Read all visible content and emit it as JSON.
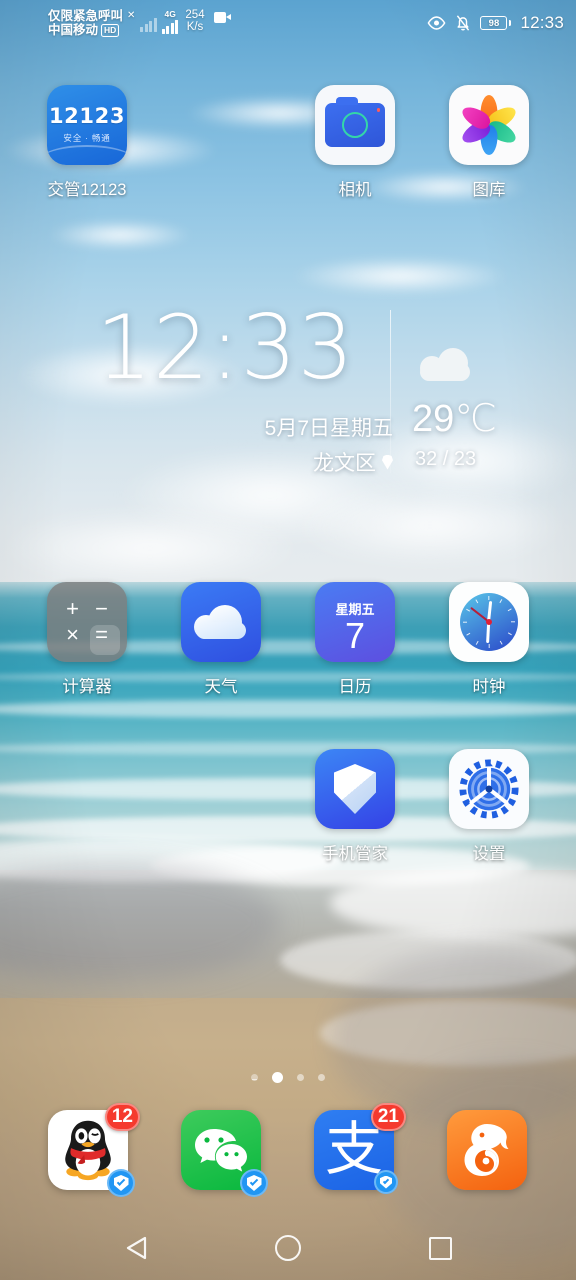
{
  "statusbar": {
    "carrier_line1": "仅限紧急呼叫",
    "carrier_line2": "中国移动",
    "hd_badge": "HD",
    "x_mark": "✕",
    "network_type": "4G",
    "net_speed_value": "254",
    "net_speed_unit": "K/s",
    "recording_icon": "video-camera-icon",
    "eye_icon": "eye-icon",
    "mute_icon": "bell-muted-icon",
    "battery_percent": "98",
    "time": "12:33"
  },
  "widget": {
    "time": "12:33",
    "date": "5月7日星期五",
    "location": "龙文区",
    "location_icon": "map-pin-icon",
    "weather_icon": "cloud-icon",
    "temperature": "29℃",
    "temp_range": "32 / 23"
  },
  "home_rows": [
    {
      "apps": [
        {
          "label": "交管12123",
          "icon": "app-12123-icon",
          "icon_text": "12123",
          "icon_subtext": "安全 · 畅通"
        },
        {
          "label": "相机",
          "icon": "camera-icon"
        },
        {
          "label": "图库",
          "icon": "gallery-icon"
        }
      ]
    },
    {
      "apps": [
        {
          "label": "计算器",
          "icon": "calculator-icon",
          "ops": [
            "+",
            "−",
            "×",
            "="
          ]
        },
        {
          "label": "天气",
          "icon": "weather-cloud-icon"
        },
        {
          "label": "日历",
          "icon": "calendar-icon",
          "weekday": "星期五",
          "day": "7"
        },
        {
          "label": "时钟",
          "icon": "analog-clock-icon"
        }
      ]
    },
    {
      "apps": [
        {
          "label": "手机管家",
          "icon": "shield-icon"
        },
        {
          "label": "设置",
          "icon": "gear-icon"
        }
      ]
    }
  ],
  "page_indicator": {
    "count": 4,
    "active_index": 1
  },
  "dock": [
    {
      "name": "QQ",
      "icon": "qq-penguin-icon",
      "badge": "12",
      "verified": true
    },
    {
      "name": "微信",
      "icon": "wechat-icon",
      "badge": "",
      "verified": true
    },
    {
      "name": "支付宝",
      "icon": "alipay-icon",
      "icon_text": "支",
      "badge": "21",
      "verified": true
    },
    {
      "name": "UC浏览器",
      "icon": "uc-browser-squirrel-icon",
      "badge": "",
      "verified": false
    }
  ],
  "navbar": {
    "back": "back-triangle-icon",
    "home": "home-circle-icon",
    "recents": "recents-square-icon"
  },
  "colors": {
    "accent_blue": "#2f7ef2",
    "badge_red": "#f53a2e",
    "verify_blue": "#2196f3",
    "wechat_green": "#09b83e",
    "uc_orange": "#f4620f"
  }
}
